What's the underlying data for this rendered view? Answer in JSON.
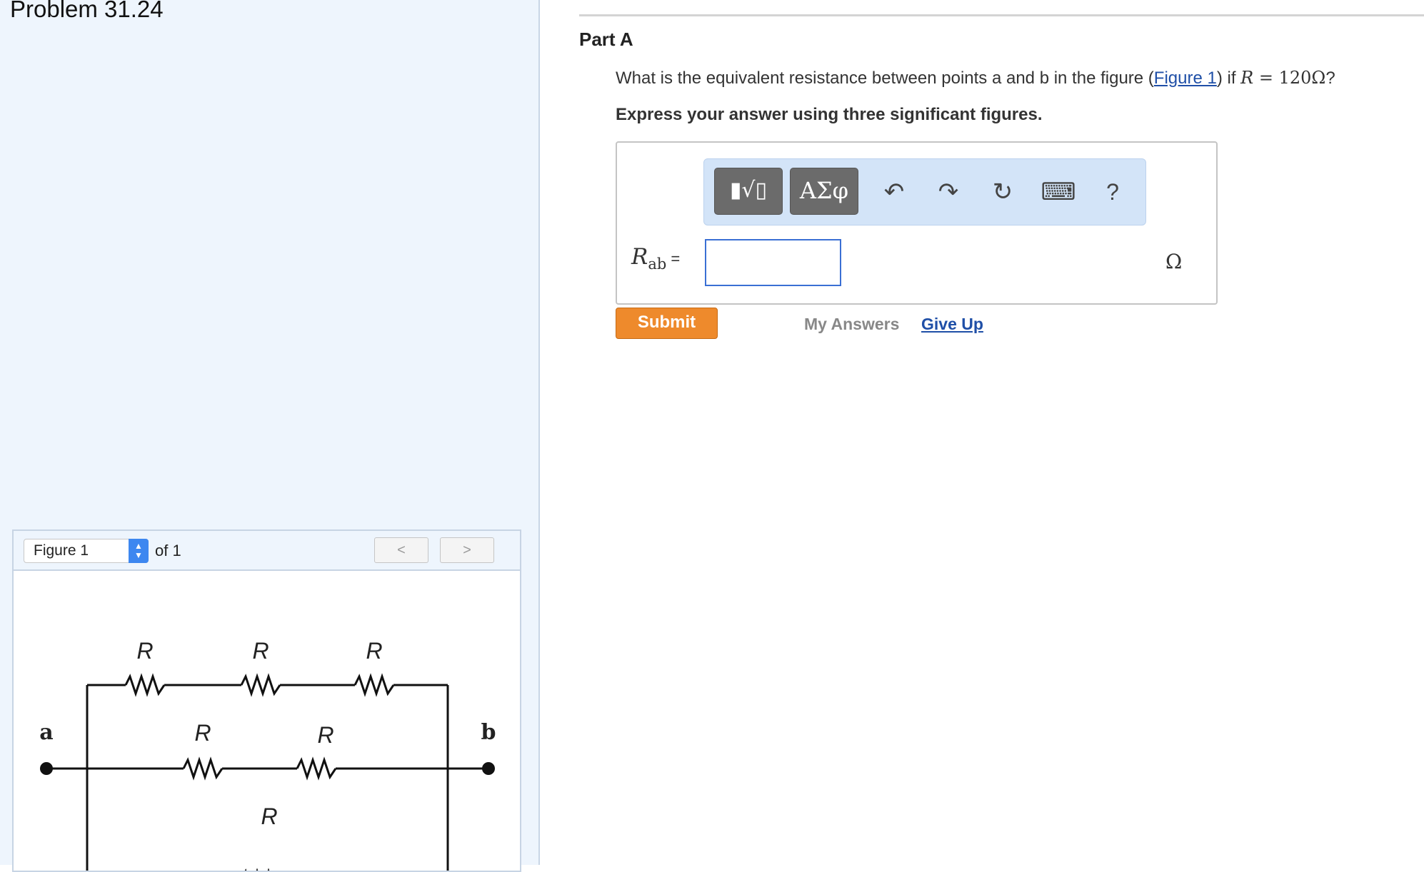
{
  "problem": {
    "title": "Problem 31.24"
  },
  "figure_panel": {
    "selector_value": "Figure 1",
    "of_label": "of 1",
    "prev_glyph": "<",
    "next_glyph": ">",
    "circuit": {
      "resistor_label": "R",
      "node_a": "a",
      "node_b": "b"
    }
  },
  "part": {
    "title": "Part A",
    "question_before": "What is the equivalent resistance between points a and b in the figure (",
    "figure_link": "Figure 1",
    "question_after": ") if ",
    "math_var": "R",
    "math_eq": " = 120Ω",
    "question_end": "?",
    "instruction": "Express your answer using three significant figures."
  },
  "answer": {
    "label_var": "R",
    "label_sub": "ab",
    "label_eq": " =",
    "value": "",
    "unit": "Ω"
  },
  "toolbar": {
    "templates_glyph": "▮√▯",
    "symbols_label": "ΑΣφ",
    "undo_glyph": "↶",
    "redo_glyph": "↷",
    "reset_glyph": "↻",
    "keyboard_glyph": "⌨",
    "help_glyph": "?"
  },
  "actions": {
    "submit_label": "Submit",
    "my_answers_label": "My Answers",
    "give_up_label": "Give Up"
  }
}
